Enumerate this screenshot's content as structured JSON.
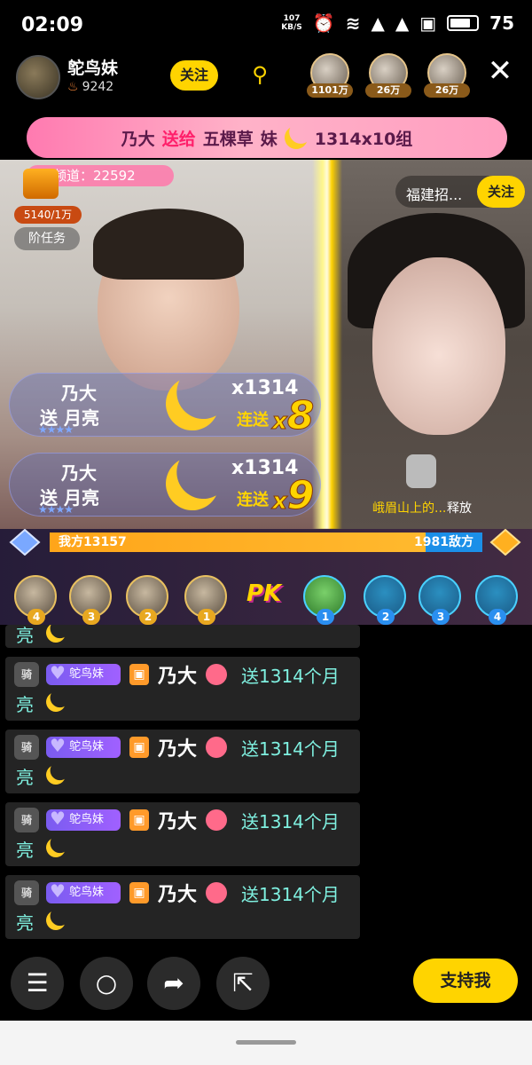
{
  "status_bar": {
    "time": "02:09",
    "net_speed": "107",
    "net_unit": "KB/S",
    "battery": "75"
  },
  "header": {
    "host_name": "鸵鸟妹",
    "host_fans": "9242",
    "follow_label": "关注",
    "viewers": [
      {
        "badge": "1101万"
      },
      {
        "badge": "26万"
      },
      {
        "badge": "26万"
      }
    ]
  },
  "gift_banner": {
    "sender": "乃大",
    "verb": "送给",
    "receiver": "五棵草",
    "receiver_tail": "妹",
    "detail": "1314x10组"
  },
  "left_overlay": {
    "channel": "频道：22592",
    "chest_count": "5140/1万",
    "task_label": "阶任务"
  },
  "opponent": {
    "name": "福建招...",
    "follow_label": "关注"
  },
  "combo_gifts": [
    {
      "sender": "乃大",
      "action": "送 月亮",
      "qty": "x1314",
      "lian": "连送",
      "x": "x",
      "count": "8"
    },
    {
      "sender": "乃大",
      "action": "送 月亮",
      "qty": "x1314",
      "lian": "连送",
      "x": "x",
      "count": "9"
    }
  ],
  "skill": {
    "user": "峨眉山上的...",
    "action": "释放"
  },
  "pk": {
    "our_label": "我方13157",
    "enemy_label": "1981敌方",
    "our_score": 13157,
    "enemy_score": 1981,
    "logo": "PK",
    "our_slots": [
      "4",
      "3",
      "2",
      "1"
    ],
    "enemy_slots": [
      "1",
      "2",
      "3",
      "4"
    ]
  },
  "chat": {
    "prev_tail": "亮",
    "messages": [
      {
        "level": "骑",
        "fan_badge": "鸵鸟妹",
        "sender": "乃大",
        "text": "送1314个月",
        "text2": "亮"
      },
      {
        "level": "骑",
        "fan_badge": "鸵鸟妹",
        "sender": "乃大",
        "text": "送1314个月",
        "text2": "亮"
      },
      {
        "level": "骑",
        "fan_badge": "鸵鸟妹",
        "sender": "乃大",
        "text": "送1314个月",
        "text2": "亮"
      },
      {
        "level": "骑",
        "fan_badge": "鸵鸟妹",
        "sender": "乃大",
        "text": "送1314个月",
        "text2": "亮"
      }
    ]
  },
  "bottom": {
    "support_label": "支持我",
    "icons": [
      "menu-icon",
      "chat-icon",
      "share-icon",
      "fullscreen-icon"
    ]
  },
  "colors": {
    "accent": "#ffd400",
    "our_bar": "#ffa51a",
    "enemy_bar": "#1b8fe8",
    "chat_text": "#7ff0e0"
  }
}
